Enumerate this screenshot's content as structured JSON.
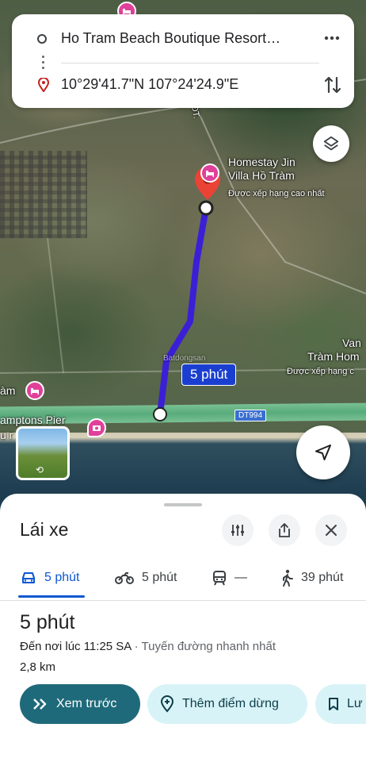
{
  "map": {
    "homestay_name_line1": "Homestay Jin",
    "homestay_name_line2": "Villa Hồ Tràm",
    "homestay_rating": "Được xếp hạng cao nhất",
    "right_label_line1": "Van",
    "right_label_line2": "Tràm Hom",
    "right_rating": "Được xếp hạng c",
    "left_label_1": "àm",
    "left_label_2": "amptons Pier",
    "left_label_3": "u r",
    "left_label_4": "n)",
    "road_label": "DT994",
    "road_label_top": "ĐT.",
    "duration_chip": "5 phút",
    "watermark": "Batdongsan",
    "route_color": "#3b1fd6",
    "poi_color": "#e0409a"
  },
  "search": {
    "origin": "Ho Tram Beach Boutique Resort…",
    "destination": "10°29'41.7\"N 107°24'24.9\"E",
    "more_icon": "more-vert-icon",
    "swap_icon": "swap-vert-icon"
  },
  "sheet": {
    "title": "Lái xe",
    "modes": [
      {
        "icon": "car-icon",
        "label": "5 phút",
        "active": true
      },
      {
        "icon": "motorbike-icon",
        "label": "5 phút",
        "active": false
      },
      {
        "icon": "transit-icon",
        "label": "—",
        "active": false
      },
      {
        "icon": "walk-icon",
        "label": "39 phút",
        "active": false
      }
    ],
    "route_time": "5 phút",
    "arrival": "Đến nơi lúc 11:25 SA",
    "separator": " · ",
    "route_note": "Tuyến đường nhanh nhất",
    "distance": "2,8 km",
    "buttons": {
      "preview": "Xem trước",
      "add_stop": "Thêm điểm dừng",
      "save": "Lư"
    }
  }
}
